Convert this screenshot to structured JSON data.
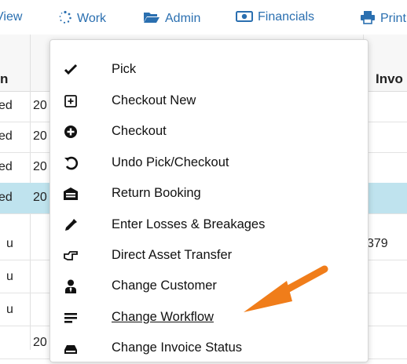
{
  "toolbar": {
    "view_label": "View",
    "work_label": "Work",
    "admin_label": "Admin",
    "financials_label": "Financials",
    "print_label": "Print"
  },
  "table": {
    "headers": {
      "col1": "n",
      "invoice": "Invo"
    },
    "rows": [
      {
        "status": "ed",
        "date": "20",
        "invoice": ""
      },
      {
        "status": "ed",
        "date": "20",
        "invoice": ""
      },
      {
        "status": "ed",
        "date": "20",
        "invoice": ""
      },
      {
        "status": "ed",
        "date": "20",
        "invoice": ""
      },
      {
        "status": "u",
        "date": "",
        "invoice": "379"
      },
      {
        "status": "u",
        "date": "",
        "invoice": ""
      },
      {
        "status": "u",
        "date": "",
        "invoice": ""
      },
      {
        "status": "",
        "date": "20",
        "invoice": ""
      }
    ]
  },
  "menu": {
    "items": [
      {
        "label": "Pick",
        "icon": "check-icon"
      },
      {
        "label": "Checkout New",
        "icon": "plus-square-icon"
      },
      {
        "label": "Checkout",
        "icon": "plus-circle-icon"
      },
      {
        "label": "Undo Pick/Checkout",
        "icon": "undo-icon"
      },
      {
        "label": "Return Booking",
        "icon": "warehouse-icon"
      },
      {
        "label": "Enter Losses & Breakages",
        "icon": "eyedropper-icon"
      },
      {
        "label": "Direct Asset Transfer",
        "icon": "hand-point-icon"
      },
      {
        "label": "Change Customer",
        "icon": "user-tie-icon"
      },
      {
        "label": "Change Workflow",
        "icon": "bars-icon"
      },
      {
        "label": "Change Invoice Status",
        "icon": "hdd-icon"
      }
    ]
  },
  "colors": {
    "link": "#2a6fb0",
    "selected_row": "#bfe3ee",
    "annotation_arrow": "#f07d1a"
  }
}
